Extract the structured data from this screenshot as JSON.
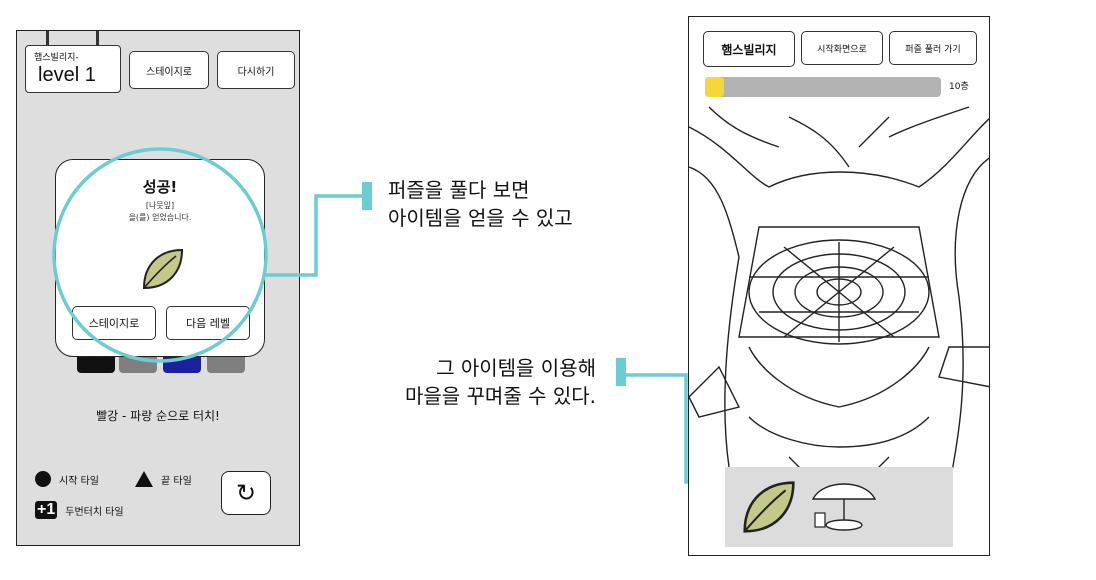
{
  "left_screen": {
    "sign": {
      "small_label": "햄스빌리지-",
      "level_label": "level 1"
    },
    "buttons": {
      "to_stage": "스테이지로",
      "retry": "다시하기"
    },
    "tiles": [
      {
        "color": "#111111"
      },
      {
        "color": "#7f7f7f"
      },
      {
        "color": "#1c1f9e"
      },
      {
        "color": "#7f7f7f"
      }
    ],
    "instruction": "빨강 - 파랑 순으로 터치!",
    "legend": {
      "start_tile": "시작 타일",
      "end_tile": "끝 타일",
      "double_touch_tile": "두번터치 타일",
      "double_touch_icon_text": "+1"
    },
    "restart_icon": "↻",
    "success_dialog": {
      "title": "성공!",
      "item_name": "[나뭇잎]",
      "message": "을(를) 얻었습니다.",
      "leaf_icon": "leaf-icon",
      "buttons": {
        "to_stage": "스테이지로",
        "next_level": "다음 레벨"
      }
    }
  },
  "callouts": {
    "first": [
      "퍼즐을 풀다 보면",
      "아이템을 얻을 수 있고"
    ],
    "second": [
      "그 아이템을 이용해",
      "마을을 꾸며줄 수 있다."
    ]
  },
  "right_screen": {
    "title_button": "햄스빌리지",
    "home_button": "시작화면으로",
    "solve_button": "퍼즐 풀러 가기",
    "progress": {
      "value": 0.08,
      "label": "10층"
    }
  },
  "colors": {
    "highlight_circle": "#69cdd1",
    "progress_fill": "#f7d63b",
    "leaf": "#c4c98a"
  }
}
